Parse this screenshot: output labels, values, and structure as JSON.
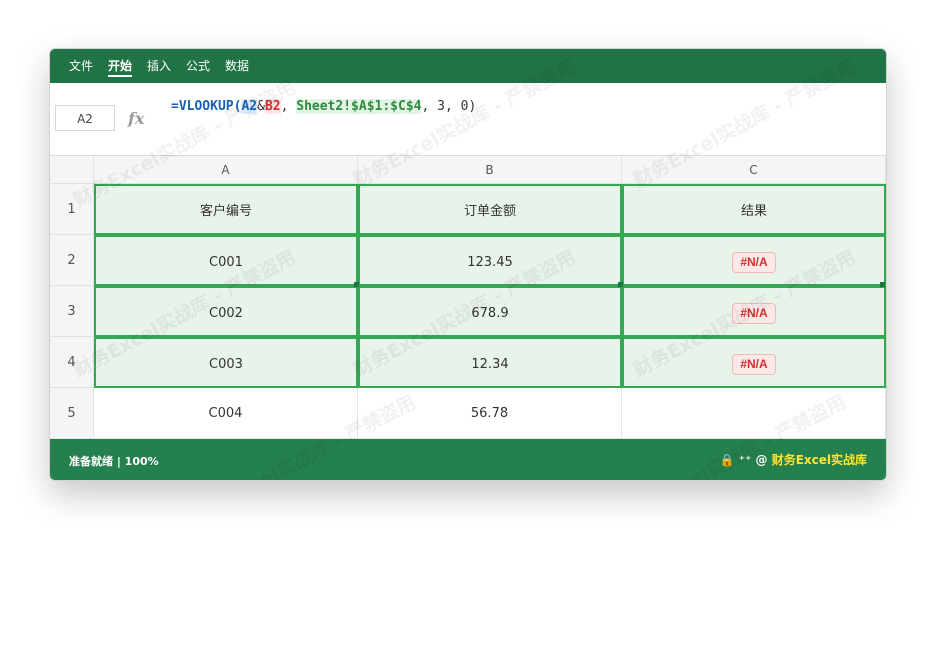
{
  "ribbon": {
    "tabs": [
      "文件",
      "开始",
      "插入",
      "公式",
      "数据"
    ],
    "active_tab": "开始"
  },
  "formula_bar": {
    "name_box": "A2",
    "fx_label": "fx",
    "formula_prefix": "=VLOOKUP(",
    "ref_a2": "A2",
    "concat_op": "&",
    "ref_b2": "B2",
    "sep1": ", ",
    "range": "Sheet2!$A$1:$C$4",
    "rest": ", 3, 0)"
  },
  "columns": [
    "A",
    "B",
    "C"
  ],
  "rows": [
    "1",
    "2",
    "3",
    "4",
    "5"
  ],
  "cells": [
    [
      "客户编号",
      "订单金额",
      "结果"
    ],
    [
      "C001",
      "123.45",
      "#N/A"
    ],
    [
      "C002",
      "678.9",
      "#N/A"
    ],
    [
      "C003",
      "12.34",
      "#N/A"
    ],
    [
      "C004",
      "56.78",
      ""
    ]
  ],
  "status_bar": {
    "left": "准备就绪 | 100%",
    "lock_icon": "🔒",
    "mid": "⁺⁺ @",
    "brand": "财务Excel实战库"
  },
  "watermark_text": "财务Excel实战库 - 严禁盗用",
  "colors": {
    "excel_green": "#217346",
    "highlight_border": "#34a853",
    "highlight_fill": "#e8f3ea",
    "error_red": "#d32f2f"
  }
}
